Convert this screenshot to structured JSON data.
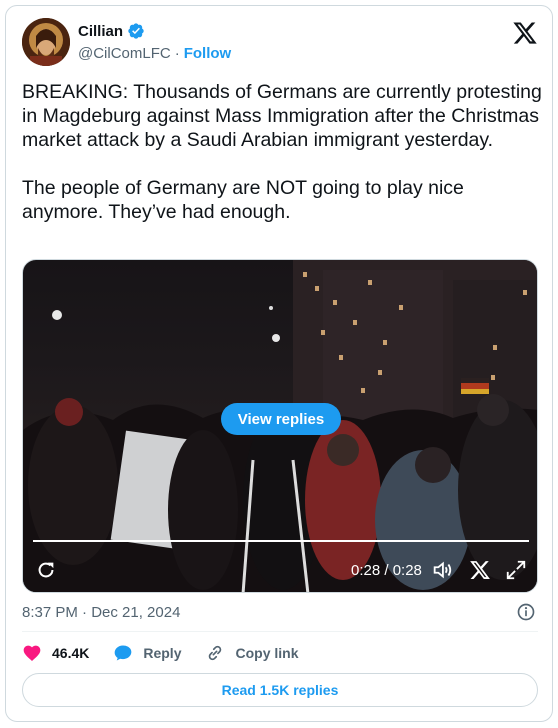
{
  "author": {
    "name": "Cillian",
    "handle": "@CilComLFC",
    "separator": "·",
    "follow_label": "Follow"
  },
  "tweet": {
    "text": "BREAKING: Thousands of Germans are currently protesting in Magdeburg against Mass Immigration after the Christmas market attack by a Saudi Arabian immigrant yesterday.\n\nThe people of Germany are NOT going to play nice anymore. They’ve had enough."
  },
  "video": {
    "overlay_button": "View replies",
    "time": "0:28 / 0:28",
    "progress": 1.0
  },
  "meta": {
    "timestamp": "8:37 PM · Dec 21, 2024"
  },
  "actions": {
    "likes": "46.4K",
    "reply_label": "Reply",
    "copy_link_label": "Copy link"
  },
  "read_replies": "Read 1.5K replies",
  "colors": {
    "accent": "#1d9bf0",
    "like": "#f91880",
    "text": "#0f1419",
    "muted": "#536471"
  }
}
